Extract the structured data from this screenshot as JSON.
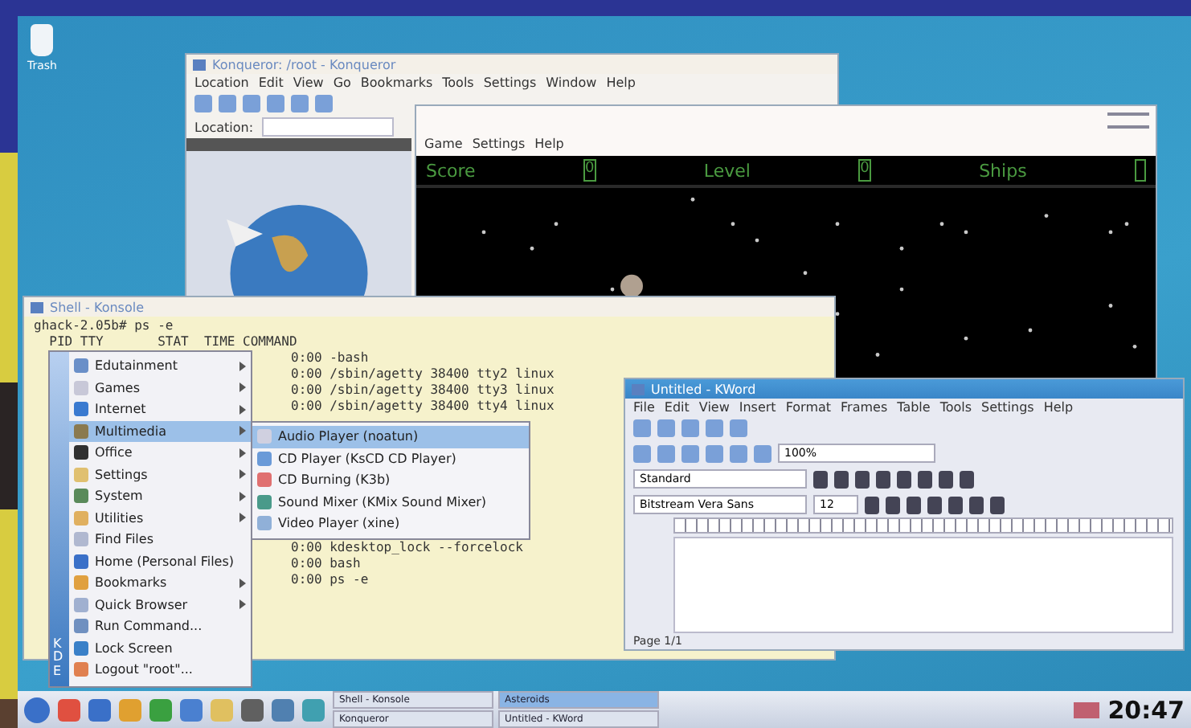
{
  "desktop": {
    "icons": [
      {
        "label": "Trash"
      }
    ]
  },
  "konqueror": {
    "title": "Konqueror: /root - Konqueror",
    "menu": [
      "Location",
      "Edit",
      "View",
      "Go",
      "Bookmarks",
      "Tools",
      "Settings",
      "Window",
      "Help"
    ],
    "location_label": "Location:"
  },
  "game": {
    "menu": [
      "Game",
      "Settings",
      "Help"
    ],
    "score_bar": [
      {
        "label": "Score",
        "value": "0"
      },
      {
        "label": "Level",
        "value": "0"
      },
      {
        "label": "Ships"
      }
    ]
  },
  "terminal": {
    "title": "Shell - Konsole",
    "header": [
      "ghack-2.05b# ps -e",
      "  PID TTY       STAT  TIME COMMAND"
    ],
    "lines_top": [
      "0:00 -bash",
      "0:00 /sbin/agetty 38400 tty2 linux",
      "0:00 /sbin/agetty 38400 tty3 linux",
      "0:00 /sbin/agetty 38400 tty4 linux"
    ],
    "lines_bottom": [
      "0:00 kdesktop_lock --forcelock",
      "0:00 bash",
      "0:00 ps -e"
    ]
  },
  "k_menu": {
    "side_label": "KDE",
    "items": [
      {
        "label": "Edutainment",
        "submenu": true,
        "selected": false,
        "color": "#6a8fc8"
      },
      {
        "label": "Games",
        "submenu": true,
        "selected": false,
        "color": "#c8c8d8"
      },
      {
        "label": "Internet",
        "submenu": true,
        "selected": false,
        "color": "#3a7ad0"
      },
      {
        "label": "Multimedia",
        "submenu": true,
        "selected": true,
        "color": "#8a7a50"
      },
      {
        "label": "Office",
        "submenu": true,
        "selected": false,
        "color": "#303030"
      },
      {
        "label": "Settings",
        "submenu": true,
        "selected": false,
        "color": "#e0c070"
      },
      {
        "label": "System",
        "submenu": true,
        "selected": false,
        "color": "#5a8a5a"
      },
      {
        "label": "Utilities",
        "submenu": true,
        "selected": false,
        "color": "#e0b060"
      },
      {
        "label": "Find Files",
        "submenu": false,
        "selected": false,
        "color": "#b0b8d0"
      },
      {
        "label": "Home (Personal Files)",
        "submenu": false,
        "selected": false,
        "color": "#3a70c8"
      },
      {
        "label": "Bookmarks",
        "submenu": true,
        "selected": false,
        "color": "#e0a040"
      },
      {
        "label": "Quick Browser",
        "submenu": true,
        "selected": false,
        "color": "#a0b0d0"
      },
      {
        "label": "Run Command...",
        "submenu": false,
        "selected": false,
        "color": "#7090c0"
      },
      {
        "label": "Lock Screen",
        "submenu": false,
        "selected": false,
        "color": "#3a80c8"
      },
      {
        "label": "Logout \"root\"...",
        "submenu": false,
        "selected": false,
        "color": "#e08050"
      }
    ],
    "submenu": [
      {
        "label": "Audio Player (noatun)",
        "selected": true,
        "color": "#d0d0e0"
      },
      {
        "label": "CD Player (KsCD CD Player)",
        "selected": false,
        "color": "#6a9ad8"
      },
      {
        "label": "CD Burning (K3b)",
        "selected": false,
        "color": "#e07070"
      },
      {
        "label": "Sound Mixer (KMix Sound Mixer)",
        "selected": false,
        "color": "#4a9a8a"
      },
      {
        "label": "Video Player (xine)",
        "selected": false,
        "color": "#90b0d8"
      }
    ]
  },
  "kword": {
    "title": "Untitled - KWord",
    "menu": [
      "File",
      "Edit",
      "View",
      "Insert",
      "Format",
      "Frames",
      "Table",
      "Tools",
      "Settings",
      "Help"
    ],
    "zoom": "100%",
    "style": "Standard",
    "font": "Bitstream Vera Sans",
    "font_size": "12",
    "status": "Page 1/1"
  },
  "taskbar": {
    "tasks": [
      {
        "label": "Shell - Konsole",
        "selected": false
      },
      {
        "label": "Asteroids",
        "selected": true
      },
      {
        "label": "Konqueror",
        "selected": false
      },
      {
        "label": "Untitled - KWord",
        "selected": false
      }
    ],
    "clock": "20:47"
  }
}
